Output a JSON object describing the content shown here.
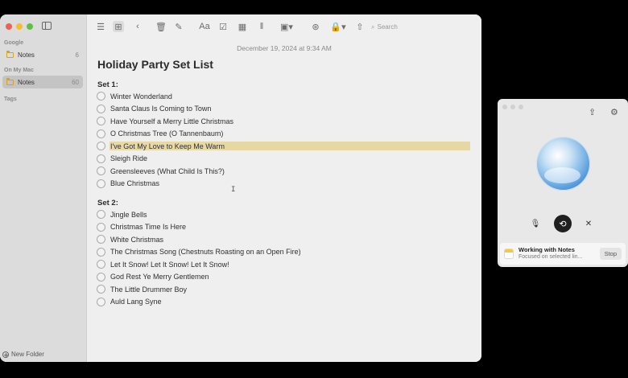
{
  "sidebar": {
    "sections": [
      {
        "label": "Google",
        "folders": [
          {
            "name": "Notes",
            "count": "6"
          }
        ]
      },
      {
        "label": "On My Mac",
        "folders": [
          {
            "name": "Notes",
            "count": "60"
          }
        ]
      },
      {
        "label": "Tags",
        "folders": []
      }
    ],
    "new_folder_label": "New Folder"
  },
  "toolbar": {
    "search_placeholder": "Search",
    "format_label": "Aa"
  },
  "note": {
    "date": "December 19, 2024 at 9:34 AM",
    "title": "Holiday Party Set List",
    "set1": {
      "heading": "Set 1:",
      "items": [
        "Winter Wonderland",
        "Santa Claus Is Coming to Town",
        "Have Yourself a Merry Little Christmas",
        "O Christmas Tree (O Tannenbaum)",
        "I've Got My Love to Keep Me Warm",
        "Sleigh Ride",
        "Greensleeves (What Child Is This?)",
        "Blue Christmas"
      ],
      "highlighted_index": 4
    },
    "set2": {
      "heading": "Set 2:",
      "items": [
        "Jingle Bells",
        "Christmas Time Is Here",
        "White Christmas",
        "The Christmas Song (Chestnuts Roasting on an Open Fire)",
        "Let It Snow! Let It Snow! Let It Snow!",
        "God Rest Ye Merry Gentlemen",
        "The Little Drummer Boy",
        "Auld Lang Syne"
      ]
    }
  },
  "assistant": {
    "status_title": "Working with Notes",
    "status_subtitle": "Focused on selected lin...",
    "stop_label": "Stop"
  },
  "colors": {
    "highlight": "#e6d7a3",
    "folder_accent": "#d9a21b",
    "orb_blue": "#3d8ad8"
  }
}
